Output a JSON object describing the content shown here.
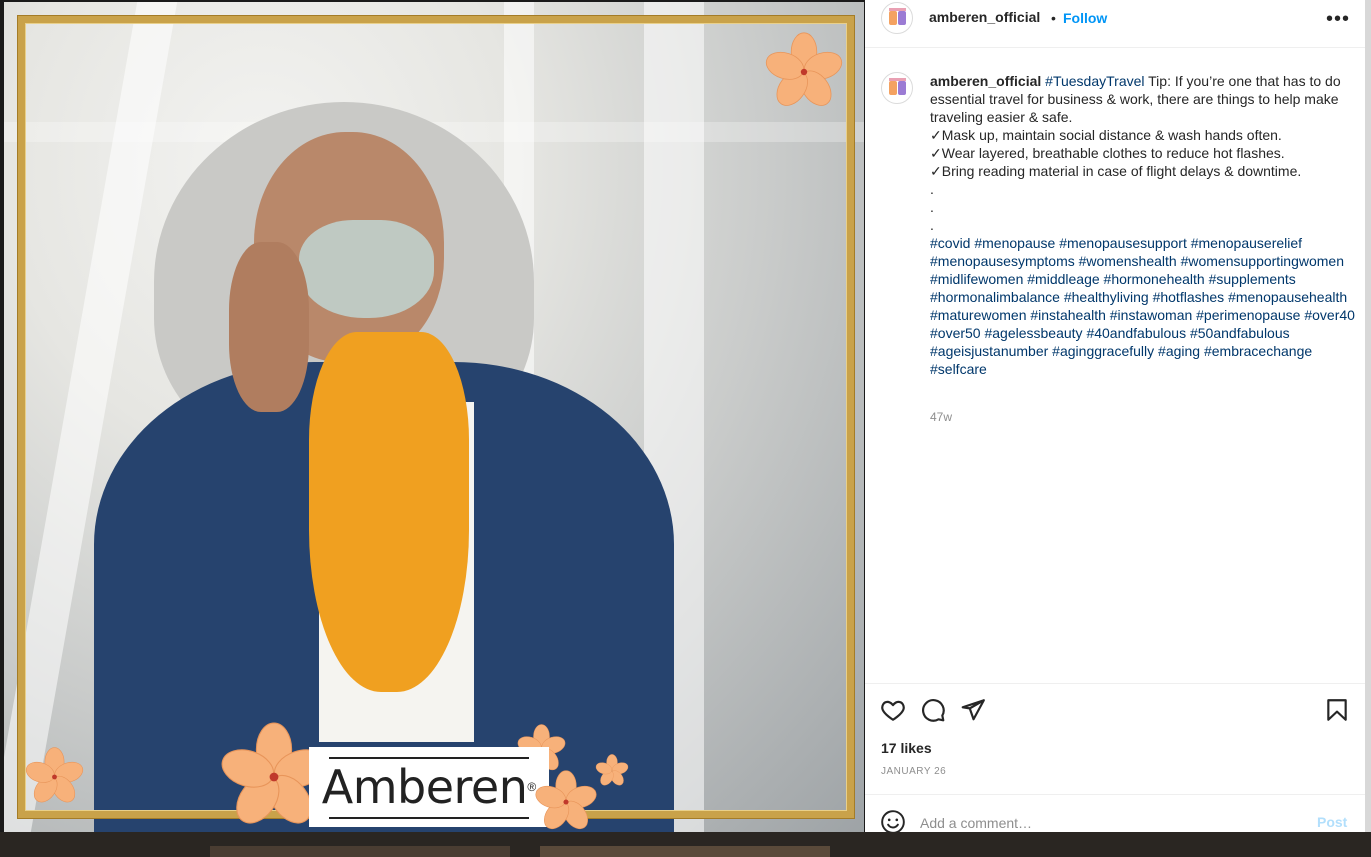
{
  "post": {
    "username": "amberen_official",
    "dot": "•",
    "follow_label": "Follow",
    "more_label": "•••"
  },
  "caption": {
    "username": "amberen_official",
    "intro_tag": "#TuesdayTravel",
    "intro_text": " Tip: If you’re one that has to do essential travel for business & work, there are things to help make traveling easier & safe.",
    "tips": [
      "✓Mask up, maintain social distance & wash hands often.",
      "✓Wear layered, breathable clothes to reduce hot flashes.",
      "✓Bring reading material in case of flight delays & downtime."
    ],
    "dots": [
      ".",
      ".",
      "."
    ],
    "hashtags": "#covid #menopause #menopausesupport #menopauserelief #menopausesymptoms #womenshealth #womensupportingwomen #midlifewomen #middleage #hormonehealth #supplements #hormonalimbalance #healthyliving #hotflashes #menopausehealth #maturewomen #instahealth #instawoman #perimenopause #over40 #over50 #agelessbeauty #40andfabulous #50andfabulous #ageisjustanumber #aginggracefully #aging #embracechange #selfcare",
    "time_ago": "47w"
  },
  "engagement": {
    "likes": "17 likes",
    "date": "JANUARY 26"
  },
  "comment": {
    "placeholder": "Add a comment…",
    "post_label": "Post"
  },
  "image": {
    "brand": "Amberen",
    "registered": "®"
  },
  "icons": {
    "like": "heart-icon",
    "comment": "comment-icon",
    "share": "share-icon",
    "save": "bookmark-icon",
    "emoji": "emoji-icon"
  },
  "colors": {
    "link_blue": "#0095f6",
    "hashtag": "#00376b",
    "gold_frame": "#c9a24a",
    "scarf": "#f0a020",
    "jacket": "#26436e",
    "flower": "#f7b17a"
  }
}
